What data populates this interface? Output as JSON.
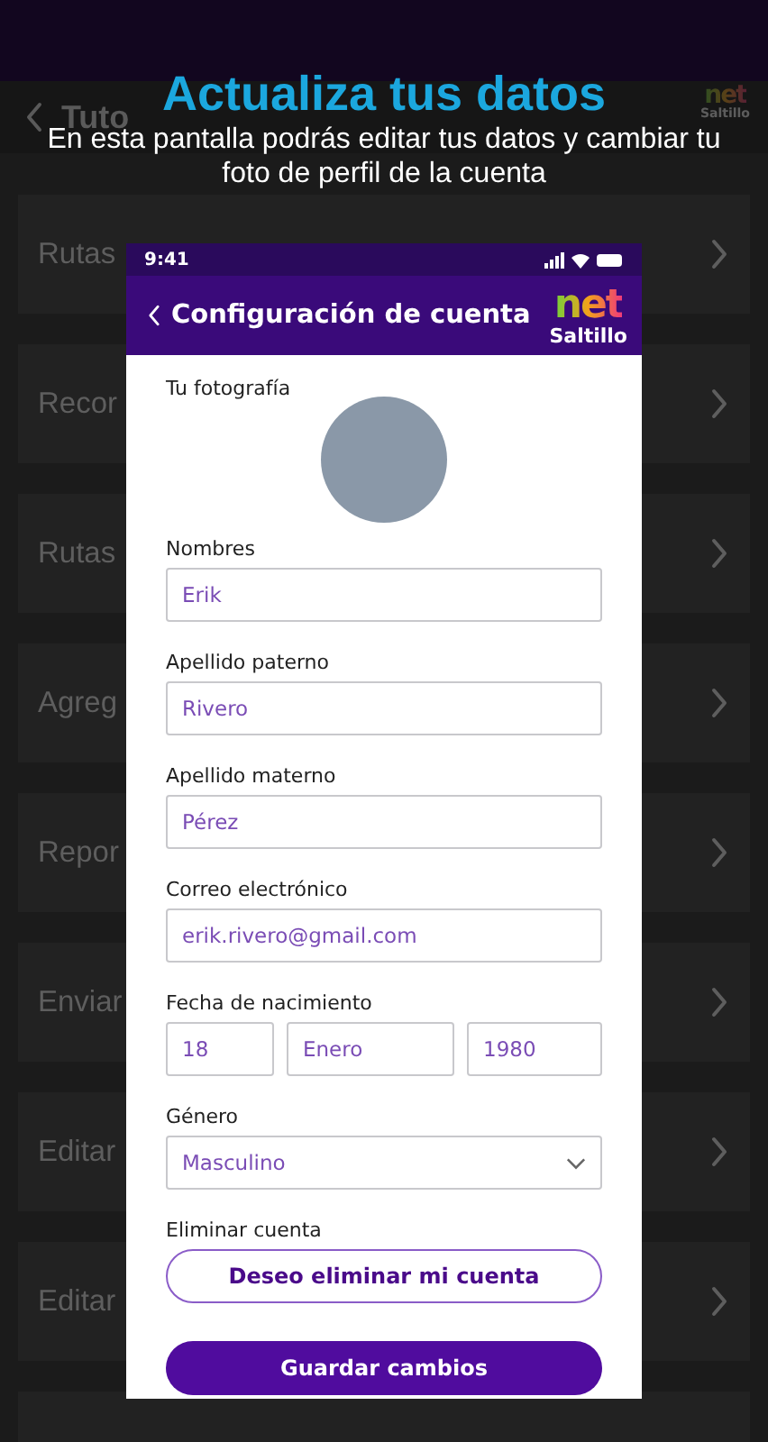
{
  "background": {
    "header": {
      "title": "Tuto",
      "logo": {
        "top": "net",
        "bottom": "Saltillo"
      }
    },
    "rows": [
      {
        "label": "Rutas"
      },
      {
        "label": "Recor"
      },
      {
        "label": "Rutas"
      },
      {
        "label": "Agreg"
      },
      {
        "label": "Repor"
      },
      {
        "label": "Enviar"
      },
      {
        "label": "Editar"
      },
      {
        "label": "Editar"
      }
    ]
  },
  "tutorial": {
    "title": "Actualiza tus datos",
    "description": "En esta pantalla podrás editar tus datos y cambiar tu foto de perfil de la cuenta"
  },
  "phone": {
    "status_bar": {
      "time": "9:41"
    },
    "header": {
      "title": "Configuración de cuenta",
      "logo": {
        "top": "net",
        "bottom": "Saltillo"
      }
    },
    "photo": {
      "label": "Tu fotografía"
    },
    "fields": [
      {
        "kind": "text",
        "label": "Nombres",
        "value": "Erik"
      },
      {
        "kind": "text",
        "label": "Apellido paterno",
        "value": "Rivero"
      },
      {
        "kind": "text",
        "label": "Apellido materno",
        "value": "Pérez"
      },
      {
        "kind": "text",
        "label": "Correo electrónico",
        "value": "erik.rivero@gmail.com"
      },
      {
        "kind": "date",
        "label": "Fecha de nacimiento",
        "parts": [
          "18",
          "Enero",
          "1980"
        ]
      },
      {
        "kind": "select",
        "label": "Género",
        "value": "Masculino"
      }
    ],
    "delete": {
      "label": "Eliminar cuenta",
      "button": "Deseo eliminar mi cuenta"
    },
    "save_button": "Guardar cambios"
  }
}
